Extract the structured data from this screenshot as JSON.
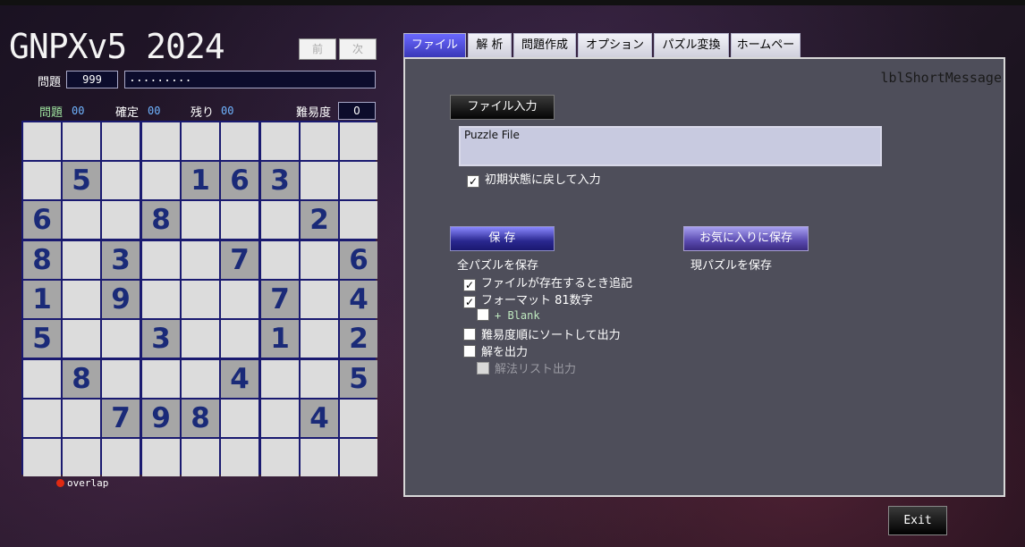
{
  "app": {
    "title": "GNPXv5 2024",
    "prev_label": "前",
    "next_label": "次"
  },
  "puzzle_info": {
    "problem_label": "問題",
    "problem_number": "999",
    "puzzle_string": "........."
  },
  "stats": {
    "problem_label": "問題",
    "problem_value": "00",
    "fixed_label": "確定",
    "fixed_value": "00",
    "remaining_label": "残り",
    "remaining_value": "00",
    "difficulty_label": "難易度",
    "difficulty_value": "0"
  },
  "board": {
    "rows": [
      [
        "",
        "",
        "",
        "",
        "",
        "",
        "",
        "",
        ""
      ],
      [
        "",
        "5",
        "",
        "",
        "1",
        "6",
        "3",
        "",
        ""
      ],
      [
        "6",
        "",
        "",
        "8",
        "",
        "",
        "",
        "2",
        ""
      ],
      [
        "8",
        "",
        "3",
        "",
        "",
        "7",
        "",
        "",
        "6"
      ],
      [
        "1",
        "",
        "9",
        "",
        "",
        "",
        "7",
        "",
        "4"
      ],
      [
        "5",
        "",
        "",
        "3",
        "",
        "",
        "1",
        "",
        "2"
      ],
      [
        "",
        "8",
        "",
        "",
        "",
        "4",
        "",
        "",
        "5"
      ],
      [
        "",
        "",
        "7",
        "9",
        "8",
        "",
        "",
        "4",
        ""
      ],
      [
        "",
        "",
        "",
        "",
        "",
        "",
        "",
        "",
        ""
      ]
    ],
    "overlap_label": "overlap",
    "given_color": "#a6a6a6",
    "empty_color": "#dcdcdc",
    "digit_color": "#1a2a78"
  },
  "tabs": [
    {
      "label": "ファイル",
      "active": true
    },
    {
      "label": "解 析",
      "active": false
    },
    {
      "label": "問題作成",
      "active": false
    },
    {
      "label": "オプション",
      "active": false
    },
    {
      "label": "パズル変換",
      "active": false
    },
    {
      "label": "ホームページ",
      "active": false
    }
  ],
  "file_panel": {
    "short_message": "lblShortMessage",
    "file_input_button": "ファイル入力",
    "puzzle_file_text": "Puzzle File",
    "reset_checkbox": {
      "label": "初期状態に戻して入力",
      "checked": true
    },
    "save_button": "保 存",
    "save_all_label": "全パズルを保存",
    "favorite_button": "お気に入りに保存",
    "save_current_label": "現パズルを保存",
    "options": [
      {
        "label": "ファイルが存在するとき追記",
        "checked": true,
        "enabled": true
      },
      {
        "label": "フォーマット 81数字",
        "checked": true,
        "enabled": true
      },
      {
        "label": "+ Blank",
        "checked": false,
        "enabled": true
      },
      {
        "label": "難易度順にソートして出力",
        "checked": false,
        "enabled": true
      },
      {
        "label": "解を出力",
        "checked": false,
        "enabled": true
      },
      {
        "label": "解法リスト出力",
        "checked": false,
        "enabled": false
      }
    ]
  },
  "exit_label": "Exit"
}
